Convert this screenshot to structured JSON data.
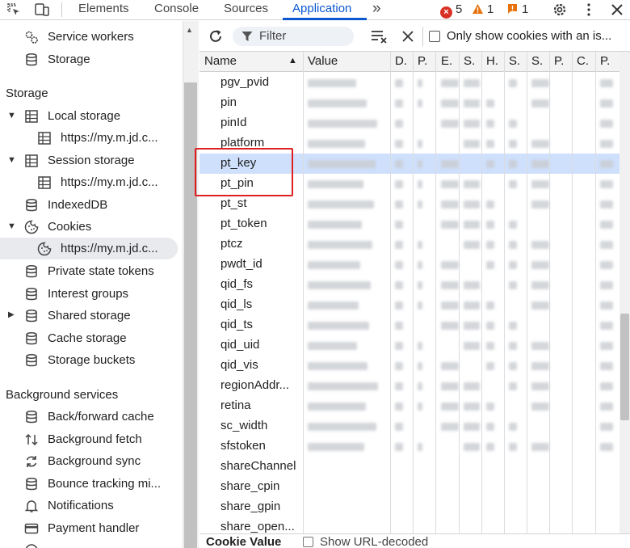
{
  "topbar": {
    "tabs": [
      "Elements",
      "Console",
      "Sources",
      "Application"
    ],
    "more": "»",
    "errors": "5",
    "warnings": "1",
    "issues": "1",
    "settings_icon": "gear-icon",
    "menu_icon": "kebab-icon",
    "close_icon": "close-icon"
  },
  "sidebar": {
    "app_items": [
      "Service workers",
      "Storage"
    ],
    "storage_heading": "Storage",
    "local_storage": "Local storage",
    "local_storage_origin": "https://my.m.jd.c...",
    "session_storage": "Session storage",
    "session_storage_origin": "https://my.m.jd.c...",
    "indexeddb": "IndexedDB",
    "cookies": "Cookies",
    "cookies_origin": "https://my.m.jd.c...",
    "storage_rest": [
      "Private state tokens",
      "Interest groups",
      "Shared storage",
      "Cache storage",
      "Storage buckets"
    ],
    "bg_heading": "Background services",
    "bg_items": [
      "Back/forward cache",
      "Background fetch",
      "Background sync",
      "Bounce tracking mi...",
      "Notifications",
      "Payment handler"
    ]
  },
  "toolbar": {
    "filter_placeholder": "Filter",
    "only_issues_label": "Only show cookies with an is..."
  },
  "table": {
    "headers": [
      "Name",
      "Value",
      "D.",
      "P.",
      "E.",
      "S.",
      "H.",
      "S.",
      "S.",
      "P.",
      "C.",
      "P."
    ],
    "rows": [
      "pgv_pvid",
      "pin",
      "pinId",
      "platform",
      "pt_key",
      "pt_pin",
      "pt_st",
      "pt_token",
      "ptcz",
      "pwdt_id",
      "qid_fs",
      "qid_ls",
      "qid_ts",
      "qid_uid",
      "qid_vis",
      "regionAddr...",
      "retina",
      "sc_width",
      "sfstoken",
      "shareChannel",
      "share_cpin",
      "share_gpin",
      "share_open..."
    ],
    "selected_row": "pt_key"
  },
  "bottom": {
    "title": "Cookie Value",
    "decode_label": "Show URL-decoded"
  },
  "colors": {
    "accent": "#0b57d0",
    "selected_row": "#cfe0fc",
    "annotation": "#e02020",
    "error": "#d93025",
    "warning": "#f29900"
  }
}
